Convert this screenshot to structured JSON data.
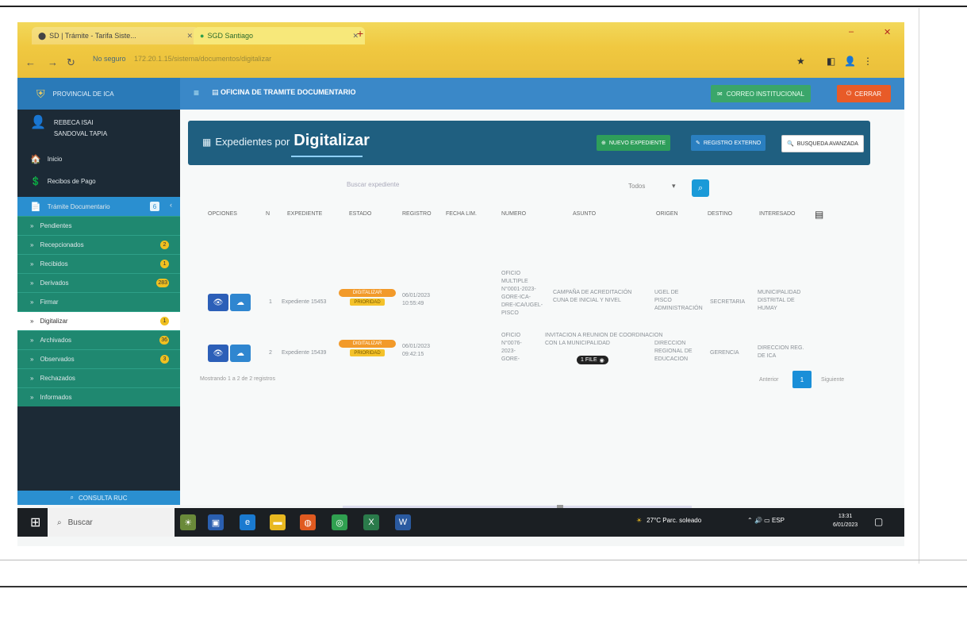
{
  "browser": {
    "tab1_title": "SD | Trámite - Tarifa Siste...",
    "tab2_title": "SGD Santiago",
    "new_tab_icon": "+",
    "security_label": "No seguro",
    "url": "172.20.1.15/sistema/documentos/digitalizar",
    "window_controls": [
      "–",
      "✕"
    ]
  },
  "appbar": {
    "brand": "PROVINCIAL DE ICA",
    "office_title": "OFICINA DE TRAMITE DOCUMENTARIO",
    "correo_label": "CORREO INSTITUCIONAL",
    "cerrar_label": "CERRAR"
  },
  "sidebar": {
    "user_line1": "REBECA ISAI",
    "user_line2": "SANDOVAL TAPIA",
    "inicio": "Inicio",
    "recibos": "Recibos de Pago",
    "docs_label": "Trámite Documentario",
    "docs_badge": "6",
    "items": [
      {
        "label": "Pendientes",
        "badge": ""
      },
      {
        "label": "Recepcionados",
        "badge": "2"
      },
      {
        "label": "Recibidos",
        "badge": "1"
      },
      {
        "label": "Derivados",
        "badge": "283"
      },
      {
        "label": "Firmar",
        "badge": ""
      },
      {
        "label": "Digitalizar",
        "badge": "1"
      },
      {
        "label": "Archivados",
        "badge": "36"
      },
      {
        "label": "Observados",
        "badge": "3"
      },
      {
        "label": "Rechazados",
        "badge": ""
      },
      {
        "label": "Informados",
        "badge": ""
      }
    ],
    "consulta": "CONSULTA RUC"
  },
  "main": {
    "title_small": "Expedientes por",
    "title_big": "Digitalizar",
    "btn_nuevo": "NUEVO EXPEDIENTE",
    "btn_registro": "REGISTRO EXTERNO",
    "btn_busqueda": "BUSQUEDA AVANZADA",
    "search_placeholder": "Buscar expediente",
    "select_value": "Todos",
    "columns": [
      "OPCIONES",
      "N",
      "EXPEDIENTE",
      "ESTADO",
      "REGISTRO",
      "FECHA LIM.",
      "NUMERO",
      "ASUNTO",
      "ORIGEN",
      "DESTINO",
      "INTERESADO"
    ],
    "rows": [
      {
        "n": "1",
        "expediente": "Expediente 15453",
        "estado": "DIGITALIZAR",
        "estado_sub": "PRIORIDAD",
        "registro": [
          "06/01/2023",
          "10:55:49"
        ],
        "numero": [
          "OFICIO",
          "MULTIPLE",
          "N°0001-2023-",
          "GORE-ICA-",
          "DRE-ICA/UGEL-",
          "PISCO"
        ],
        "asunto": [
          "CAMPAÑA DE ACREDITACIÓN",
          "CUNA DE INICIAL Y NIVEL"
        ],
        "origen": [
          "UGEL DE",
          "PISCO",
          "ADMINISTRACIÓN"
        ],
        "destino": "SECRETARIA",
        "interesado": [
          "MUNICIPALIDAD",
          "DISTRITAL DE",
          "HUMAY"
        ],
        "pill": ""
      },
      {
        "n": "2",
        "expediente": "Expediente 15439",
        "estado": "DIGITALIZAR",
        "estado_sub": "PRIORIDAD",
        "registro": [
          "06/01/2023",
          "09:42:15"
        ],
        "numero": [
          "OFICIO",
          "N°0076-",
          "2023-",
          "GORE-"
        ],
        "asunto": [
          "INVITACION A REUNION DE COORDINACION",
          "CON LA MUNICIPALIDAD"
        ],
        "origen": [
          "DIRECCION",
          "REGIONAL DE",
          "EDUCACION"
        ],
        "destino": "GERENCIA",
        "interesado": [
          "DIRECCION REG.",
          "DE ICA"
        ],
        "pill": "1 FILE"
      }
    ],
    "mostrando": "Mostrando 1 a 2 de 2 registros",
    "prev": "Anterior",
    "page": "1",
    "next": "Siguiente"
  },
  "taskbar": {
    "search": "Buscar",
    "weather": "27°C  Parc. soleado",
    "tray": "ESP",
    "time": "13:31",
    "date": "6/01/2023"
  }
}
